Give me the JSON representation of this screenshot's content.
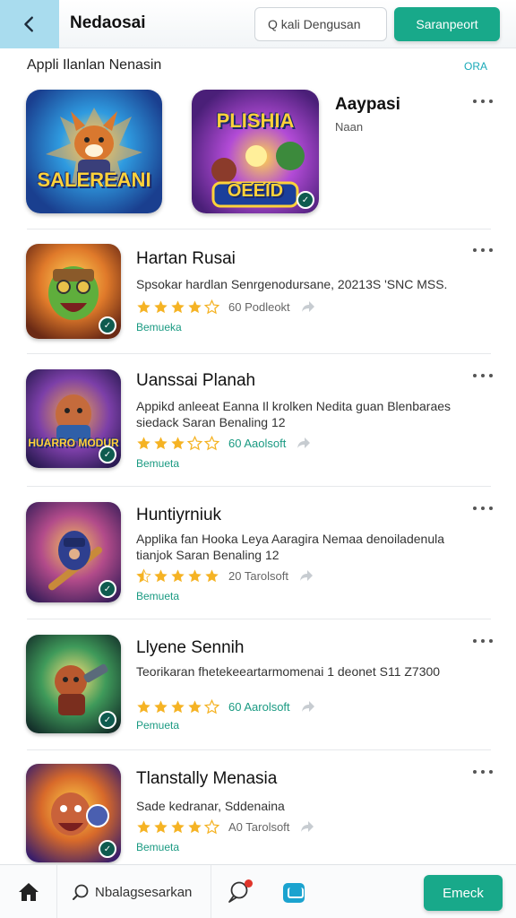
{
  "header": {
    "back_icon": "chevron-left-icon",
    "title": "Nedaosai",
    "search_placeholder": "Q kali Dengusan",
    "cta_label": "Saranpeort",
    "accent_color": "#18a98a",
    "back_bg_color": "#a9dcee"
  },
  "section": {
    "title": "Appli Ilanlan Nenasin",
    "link": "ORA"
  },
  "featured": {
    "tiles": [
      {
        "art_text": "SALEREANI"
      },
      {
        "art_text_top": "PLISHIA",
        "art_text_bottom": "OEEID"
      }
    ],
    "side_title": "Aaypasi",
    "side_subtitle": "Naan"
  },
  "apps": [
    {
      "name": "Hartan Rusai",
      "description": "Spsokar hardlan Senrgenodursane, 20213S 'SNC MSS.",
      "stars": 4,
      "rating_text": "60 Podleokt",
      "status": "Bemueka"
    },
    {
      "name": "Uanssai Planah",
      "description": "Appikd anleeat Eanna Il krolken Nedita guan Blenbaraes siedack Saran Benaling 12",
      "icon_text": "HUARRO MODUR",
      "stars": 3,
      "rating_text": "60 Aaolsoft",
      "status": "Bemueta"
    },
    {
      "name": "Huntiyrniuk",
      "description": "Applika fan Hooka Leya Aaragira Nemaa denoiladenula tianjok Saran Benaling 12",
      "stars": 4,
      "rating_text": "20 Tarolsoft",
      "status": "Bemueta"
    },
    {
      "name": "Llyene Sennih",
      "description": "Teorikaran fhetekeeartarmomenai 1 deonet S11 Z7300",
      "stars": 4,
      "rating_text": "60 Aarolsoft",
      "status": "Pemueta"
    },
    {
      "name": "Tlanstally Menasia",
      "description": "Sade kedranar, Sddenaina",
      "stars": 4,
      "rating_text": "A0 Tarolsoft",
      "status": "Bemueta"
    }
  ],
  "bottom_bar": {
    "home_icon": "home-icon",
    "search_label": "Nbalagsesarkan",
    "chat_icon": "chat-icon",
    "app_icon": "app-icon",
    "cta_label": "Emeck"
  }
}
